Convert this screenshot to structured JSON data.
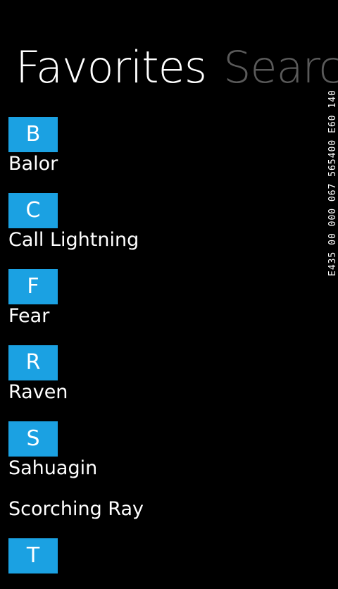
{
  "pivot": {
    "items": [
      {
        "label": "Favorites",
        "active": true
      },
      {
        "label": "Search",
        "active": false
      }
    ]
  },
  "debug_counter": "E435 00 000 067 565400 E60 140",
  "favorites": {
    "groups": [
      {
        "letter": "B",
        "entries": [
          "Balor"
        ]
      },
      {
        "letter": "C",
        "entries": [
          "Call Lightning"
        ]
      },
      {
        "letter": "F",
        "entries": [
          "Fear"
        ]
      },
      {
        "letter": "R",
        "entries": [
          "Raven"
        ]
      },
      {
        "letter": "S",
        "entries": [
          "Sahuagin",
          "Scorching Ray"
        ]
      },
      {
        "letter": "T",
        "entries": []
      }
    ]
  },
  "colors": {
    "accent": "#1ba1e2",
    "background": "#000000",
    "inactive_header": "#5a5a5a"
  }
}
